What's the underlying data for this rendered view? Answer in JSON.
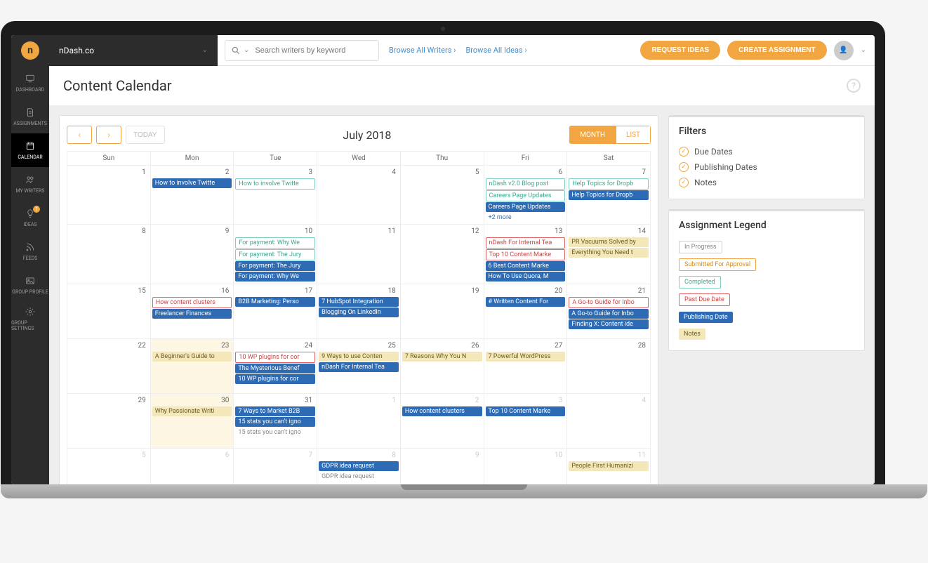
{
  "header": {
    "org": "nDash.co",
    "search_placeholder": "Search writers by keyword",
    "link_writers": "Browse All Writers ›",
    "link_ideas": "Browse All Ideas ›",
    "btn_request": "REQUEST IDEAS",
    "btn_create": "CREATE ASSIGNMENT"
  },
  "sidebar": {
    "items": [
      {
        "label": "DASHBOARD",
        "icon": "monitor"
      },
      {
        "label": "ASSIGNMENTS",
        "icon": "document"
      },
      {
        "label": "CALENDAR",
        "icon": "calendar",
        "active": true
      },
      {
        "label": "MY WRITERS",
        "icon": "users"
      },
      {
        "label": "IDEAS",
        "icon": "bulb",
        "badge": "1"
      },
      {
        "label": "FEEDS",
        "icon": "rss"
      },
      {
        "label": "GROUP PROFILE",
        "icon": "image"
      },
      {
        "label": "GROUP SETTINGS",
        "icon": "gear"
      }
    ]
  },
  "page": {
    "title": "Content Calendar"
  },
  "calendar": {
    "title": "July 2018",
    "today_label": "TODAY",
    "view_month": "MONTH",
    "view_list": "LIST",
    "days": [
      "Sun",
      "Mon",
      "Tue",
      "Wed",
      "Thu",
      "Fri",
      "Sat"
    ],
    "weeks": [
      [
        {
          "n": 1
        },
        {
          "n": 2,
          "events": [
            {
              "t": "publishing",
              "txt": "How to involve Twitte"
            }
          ]
        },
        {
          "n": 3,
          "events": [
            {
              "t": "completed",
              "txt": "How to involve Twitte"
            }
          ]
        },
        {
          "n": 4
        },
        {
          "n": 5
        },
        {
          "n": 6,
          "events": [
            {
              "t": "completed",
              "txt": "nDash v2.0 Blog post"
            },
            {
              "t": "completed",
              "txt": "Careers Page Updates"
            },
            {
              "t": "publishing",
              "txt": "Careers Page Updates"
            }
          ],
          "more": "+2 more"
        },
        {
          "n": 7,
          "events": [
            {
              "t": "completed",
              "txt": "Help Topics for Dropb"
            },
            {
              "t": "publishing",
              "txt": "Help Topics for Dropb"
            }
          ]
        }
      ],
      [
        {
          "n": 8
        },
        {
          "n": 9
        },
        {
          "n": 10,
          "events": [
            {
              "t": "completed",
              "txt": "For payment: Why We"
            },
            {
              "t": "completed",
              "txt": "For payment: The Jury"
            },
            {
              "t": "publishing",
              "txt": "For payment: The Jury"
            },
            {
              "t": "publishing",
              "txt": "For payment: Why We"
            }
          ]
        },
        {
          "n": 11
        },
        {
          "n": 12
        },
        {
          "n": 13,
          "events": [
            {
              "t": "pastdue",
              "txt": "nDash For Internal Tea"
            },
            {
              "t": "pastdue",
              "txt": "Top 10 Content Marke"
            },
            {
              "t": "publishing",
              "txt": "6 Best Content Marke"
            },
            {
              "t": "publishing",
              "txt": "How To Use Quora, M"
            }
          ]
        },
        {
          "n": 14,
          "events": [
            {
              "t": "notes",
              "txt": "PR Vacuums Solved by"
            },
            {
              "t": "notes",
              "txt": "Everything You Need t"
            }
          ]
        }
      ],
      [
        {
          "n": 15
        },
        {
          "n": 16,
          "events": [
            {
              "t": "pastdue",
              "txt": "How content clusters"
            },
            {
              "t": "publishing",
              "txt": "Freelancer Finances"
            }
          ]
        },
        {
          "n": 17,
          "events": [
            {
              "t": "publishing",
              "txt": "B2B Marketing: Perso"
            }
          ]
        },
        {
          "n": 18,
          "events": [
            {
              "t": "publishing",
              "txt": "7 HubSpot Integration"
            },
            {
              "t": "publishing",
              "txt": "Blogging On LinkedIn"
            }
          ]
        },
        {
          "n": 19
        },
        {
          "n": 20,
          "events": [
            {
              "t": "publishing",
              "txt": "# Written Content For"
            }
          ]
        },
        {
          "n": 21,
          "events": [
            {
              "t": "pastdue",
              "txt": "A Go-to Guide for Inbo"
            },
            {
              "t": "publishing",
              "txt": "A Go-to Guide for Inbo"
            },
            {
              "t": "publishing",
              "txt": "Finding X: Content ide"
            }
          ]
        }
      ],
      [
        {
          "n": 22
        },
        {
          "n": 23,
          "note": true,
          "events": [
            {
              "t": "notes",
              "txt": "A Beginner's Guide to"
            }
          ]
        },
        {
          "n": 24,
          "events": [
            {
              "t": "pastdue",
              "txt": "10 WP plugins for cor"
            },
            {
              "t": "publishing",
              "txt": "The Mysterious Benef"
            },
            {
              "t": "publishing",
              "txt": "10 WP plugins for cor"
            }
          ]
        },
        {
          "n": 25,
          "events": [
            {
              "t": "notes",
              "txt": "9 Ways to use Conten"
            },
            {
              "t": "publishing",
              "txt": "nDash For Internal Tea"
            }
          ]
        },
        {
          "n": 26,
          "events": [
            {
              "t": "notes",
              "txt": "7 Reasons Why You N"
            }
          ]
        },
        {
          "n": 27,
          "events": [
            {
              "t": "notes",
              "txt": "7 Powerful WordPress"
            }
          ]
        },
        {
          "n": 28
        }
      ],
      [
        {
          "n": 29
        },
        {
          "n": 30,
          "note": true,
          "events": [
            {
              "t": "notes",
              "txt": "Why Passionate Writi"
            }
          ]
        },
        {
          "n": 31,
          "events": [
            {
              "t": "publishing",
              "txt": "7 Ways to Market B2B"
            },
            {
              "t": "publishing",
              "txt": "15 stats you can't igno"
            },
            {
              "t": "inprogress",
              "txt": "15 stats you can't igno"
            }
          ]
        },
        {
          "n": 1,
          "other": true
        },
        {
          "n": 2,
          "other": true,
          "events": [
            {
              "t": "publishing",
              "txt": "How content clusters"
            }
          ]
        },
        {
          "n": 3,
          "other": true,
          "events": [
            {
              "t": "publishing",
              "txt": "Top 10 Content Marke"
            }
          ]
        },
        {
          "n": 4,
          "other": true
        }
      ],
      [
        {
          "n": 5,
          "other": true
        },
        {
          "n": 6,
          "other": true
        },
        {
          "n": 7,
          "other": true
        },
        {
          "n": 8,
          "other": true,
          "events": [
            {
              "t": "publishing",
              "txt": "GDPR idea request"
            },
            {
              "t": "inprogress",
              "txt": "GDPR idea request"
            }
          ]
        },
        {
          "n": 9,
          "other": true
        },
        {
          "n": 10,
          "other": true
        },
        {
          "n": 11,
          "other": true,
          "events": [
            {
              "t": "notes",
              "txt": "People First Humanizi"
            }
          ]
        }
      ]
    ]
  },
  "filters": {
    "title": "Filters",
    "items": [
      "Due Dates",
      "Publishing Dates",
      "Notes"
    ]
  },
  "legend": {
    "title": "Assignment Legend",
    "items": [
      {
        "cls": "leg-inprogress",
        "txt": "In Progress"
      },
      {
        "cls": "leg-submitted",
        "txt": "Submitted For Approval"
      },
      {
        "cls": "leg-completed",
        "txt": "Completed"
      },
      {
        "cls": "leg-pastdue",
        "txt": "Past Due Date"
      },
      {
        "cls": "leg-publishing",
        "txt": "Publishing Date"
      },
      {
        "cls": "leg-notes",
        "txt": "Notes"
      }
    ]
  }
}
